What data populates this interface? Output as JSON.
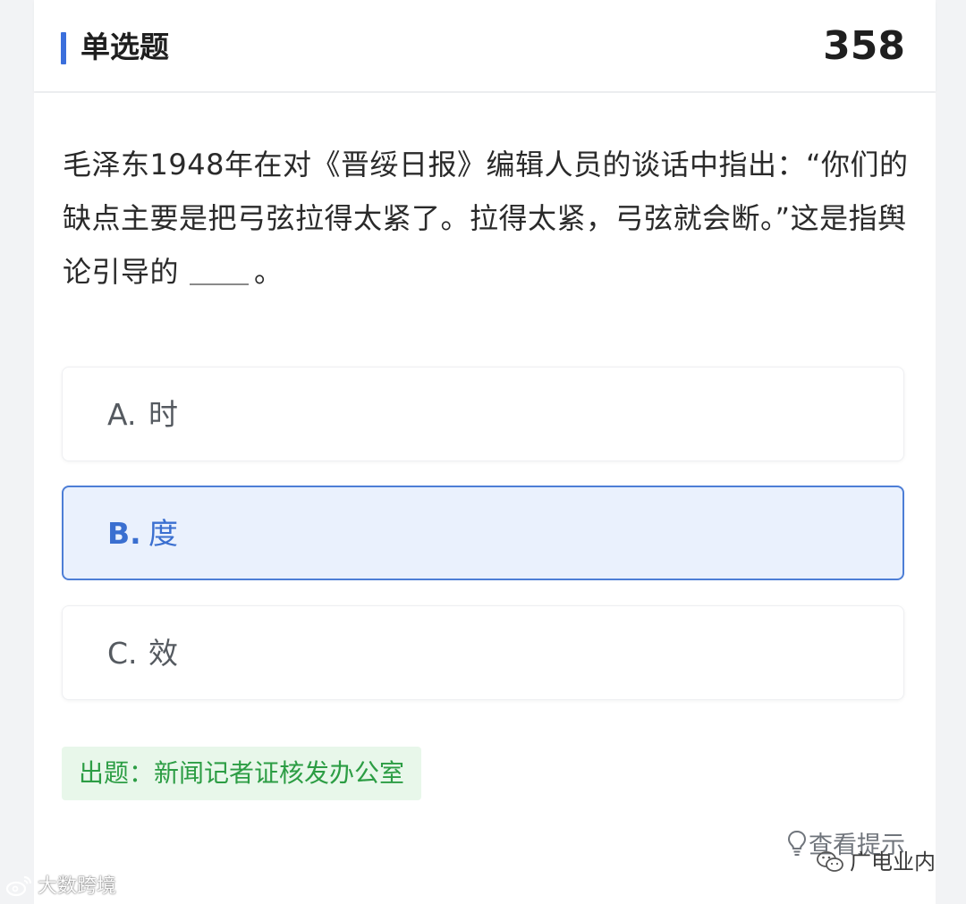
{
  "header": {
    "title": "单选题",
    "question_number": "358"
  },
  "question": {
    "text_before_blank": "毛泽东1948年在对《晋绥日报》编辑人员的谈话中指出：“你们的缺点主要是把弓弦拉得太紧了。拉得太紧，弓弦就会断。”这是指舆论引导的",
    "text_after_blank": "。"
  },
  "options": [
    {
      "letter": "A.",
      "text": "时",
      "selected": false
    },
    {
      "letter": "B.",
      "text": "度",
      "selected": true
    },
    {
      "letter": "C.",
      "text": "效",
      "selected": false
    }
  ],
  "source_label": "出题：新闻记者证核发办公室",
  "hint_label": "查看提示",
  "watermark_left": "大数跨境",
  "watermark_right": "广电业内",
  "colors": {
    "accent": "#3b6fdc",
    "selected_bg": "#eaf1fd",
    "source_green": "#2c9d44",
    "source_bg": "#e8f7ea"
  },
  "icons": [
    "lightbulb-icon",
    "weibo-icon",
    "wechat-icon"
  ]
}
